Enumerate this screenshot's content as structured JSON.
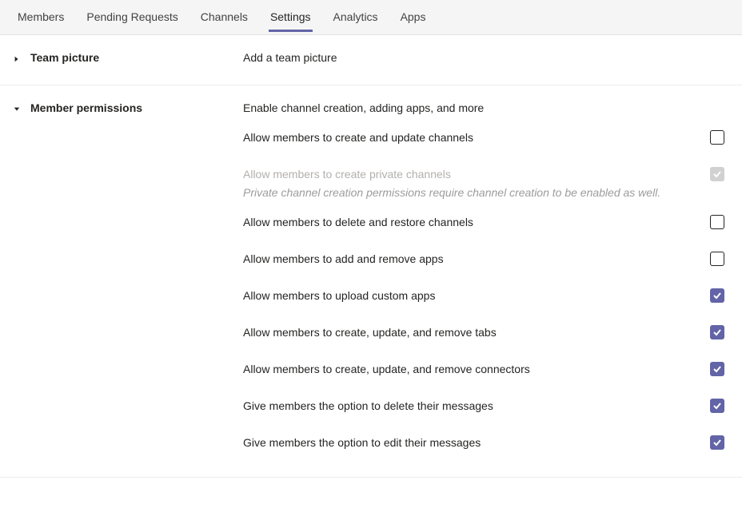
{
  "tabs": [
    {
      "label": "Members",
      "active": false
    },
    {
      "label": "Pending Requests",
      "active": false
    },
    {
      "label": "Channels",
      "active": false
    },
    {
      "label": "Settings",
      "active": true
    },
    {
      "label": "Analytics",
      "active": false
    },
    {
      "label": "Apps",
      "active": false
    }
  ],
  "sections": {
    "teamPicture": {
      "title": "Team picture",
      "desc": "Add a team picture",
      "expanded": false
    },
    "memberPermissions": {
      "title": "Member permissions",
      "desc": "Enable channel creation, adding apps, and more",
      "expanded": true,
      "items": [
        {
          "label": "Allow members to create and update channels",
          "checked": false,
          "disabled": false
        },
        {
          "label": "Allow members to create private channels",
          "checked": true,
          "disabled": true,
          "note": "Private channel creation permissions require channel creation to be enabled as well."
        },
        {
          "label": "Allow members to delete and restore channels",
          "checked": false,
          "disabled": false
        },
        {
          "label": "Allow members to add and remove apps",
          "checked": false,
          "disabled": false
        },
        {
          "label": "Allow members to upload custom apps",
          "checked": true,
          "disabled": false
        },
        {
          "label": "Allow members to create, update, and remove tabs",
          "checked": true,
          "disabled": false
        },
        {
          "label": "Allow members to create, update, and remove connectors",
          "checked": true,
          "disabled": false
        },
        {
          "label": "Give members the option to delete their messages",
          "checked": true,
          "disabled": false
        },
        {
          "label": "Give members the option to edit their messages",
          "checked": true,
          "disabled": false
        }
      ]
    }
  }
}
